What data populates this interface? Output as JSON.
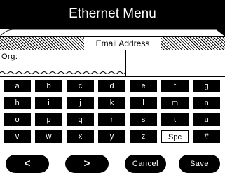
{
  "window": {
    "title": "Ethernet Menu"
  },
  "section": {
    "title": "Email Address"
  },
  "field": {
    "label": "Org:",
    "value": ""
  },
  "keypad": {
    "rows": [
      [
        "a",
        "b",
        "c",
        "d",
        "e",
        "f",
        "g"
      ],
      [
        "h",
        "i",
        "j",
        "k",
        "l",
        "m",
        "n"
      ],
      [
        "o",
        "p",
        "q",
        "r",
        "s",
        "t",
        "u"
      ],
      [
        "v",
        "w",
        "x",
        "y",
        "z",
        "Spc",
        "#"
      ]
    ]
  },
  "buttons": {
    "left": "<",
    "right": ">",
    "cancel": "Cancel",
    "save": "Save"
  }
}
